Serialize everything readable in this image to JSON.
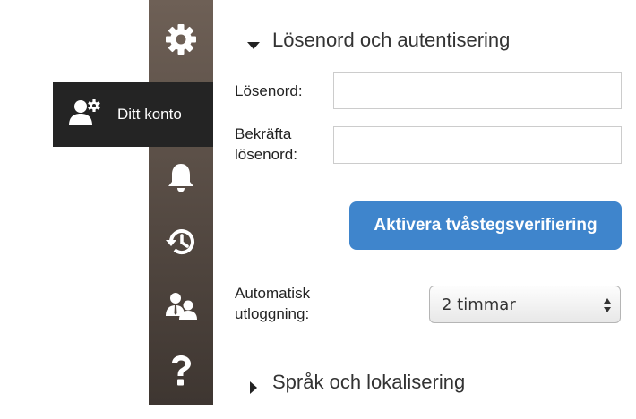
{
  "sidebar": {
    "items": [
      {
        "icon": "gear-icon"
      },
      {
        "icon": "user-settings-icon",
        "label": "Ditt konto",
        "active": true
      },
      {
        "icon": "bell-icon"
      },
      {
        "icon": "history-icon"
      },
      {
        "icon": "users-icon"
      },
      {
        "icon": "question-icon"
      }
    ]
  },
  "password_section": {
    "title": "Lösenord och autentisering",
    "expanded": true,
    "password_label": "Lösenord:",
    "password_value": "",
    "confirm_label_line1": "Bekräfta",
    "confirm_label_line2": "lösenord:",
    "confirm_value": "",
    "two_factor_button": "Aktivera tvåstegsverifiering",
    "auto_logout_label_line1": "Automatisk",
    "auto_logout_label_line2": "utloggning:",
    "auto_logout_value": "2 timmar"
  },
  "language_section": {
    "title": "Språk och lokalisering",
    "expanded": false
  },
  "colors": {
    "sidebar_top": "#6e6056",
    "sidebar_bottom": "#3e3631",
    "active_item": "#242424",
    "primary_button": "#3f85cc"
  }
}
